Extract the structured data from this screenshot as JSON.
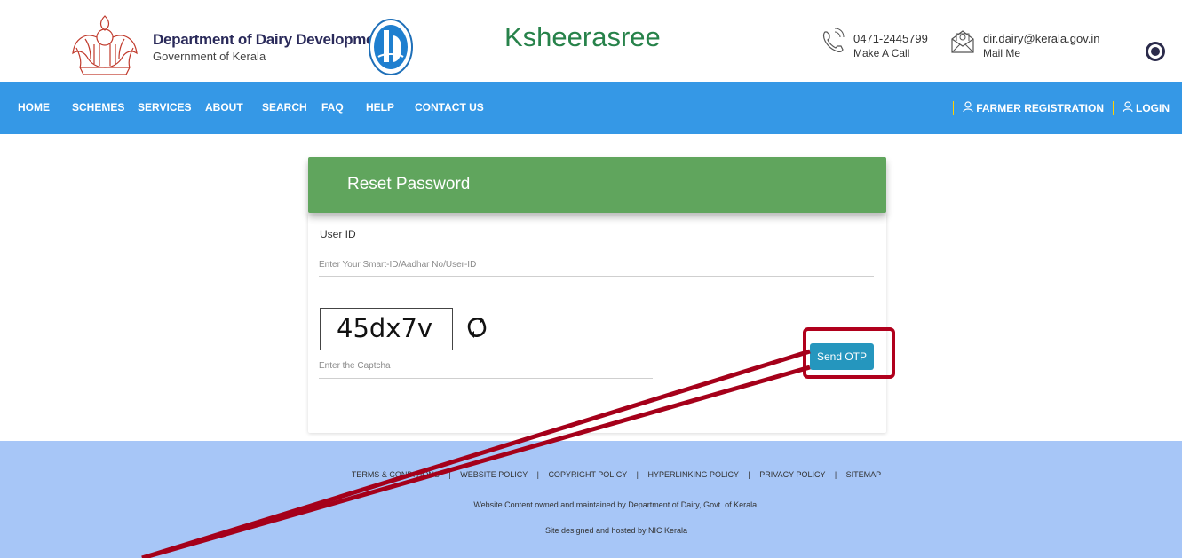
{
  "header": {
    "dept_title": "Department of Dairy Development",
    "dept_subtitle": "Government of Kerala",
    "site_title": "Ksheerasree",
    "phone_number": "0471-2445799",
    "phone_caption": "Make A Call",
    "email": "dir.dairy@kerala.gov.in",
    "email_caption": "Mail Me",
    "icons": {
      "emblem": "kerala-emblem",
      "dairy_logo": "dairy-department-logo",
      "phone": "phone-icon",
      "mail": "mail-icon",
      "accessibility": "accessibility-icon"
    }
  },
  "nav": {
    "items": [
      {
        "label": "HOME"
      },
      {
        "label": "SCHEMES"
      },
      {
        "label": "SERVICES"
      },
      {
        "label": "ABOUT"
      },
      {
        "label": "SEARCH"
      },
      {
        "label": "FAQ"
      },
      {
        "label": "HELP"
      },
      {
        "label": "CONTACT US"
      }
    ],
    "farmer_registration": "FARMER REGISTRATION",
    "login": "LOGIN",
    "background_color": "#3598e6"
  },
  "form": {
    "title": "Reset Password",
    "user_id_label": "User ID",
    "user_id_placeholder": "Enter Your Smart-ID/Aadhar No/User-ID",
    "captcha_text": "45dx7v",
    "captcha_placeholder": "Enter the Captcha",
    "send_otp_label": "Send OTP",
    "header_color": "#60a55d",
    "button_color": "#2596be"
  },
  "footer": {
    "links": [
      "TERMS & CONDITIONS",
      "WEBSITE POLICY",
      "COPYRIGHT POLICY",
      "HYPERLINKING POLICY",
      "PRIVACY POLICY",
      "SITEMAP"
    ],
    "separator": "|",
    "ownership": "Website Content owned and maintained by Department of Dairy, Govt. of Kerala.",
    "hosting": "Site designed and hosted by NIC Kerala",
    "background_color": "#a7c6f7"
  },
  "annotation": {
    "color": "#b0001c"
  }
}
